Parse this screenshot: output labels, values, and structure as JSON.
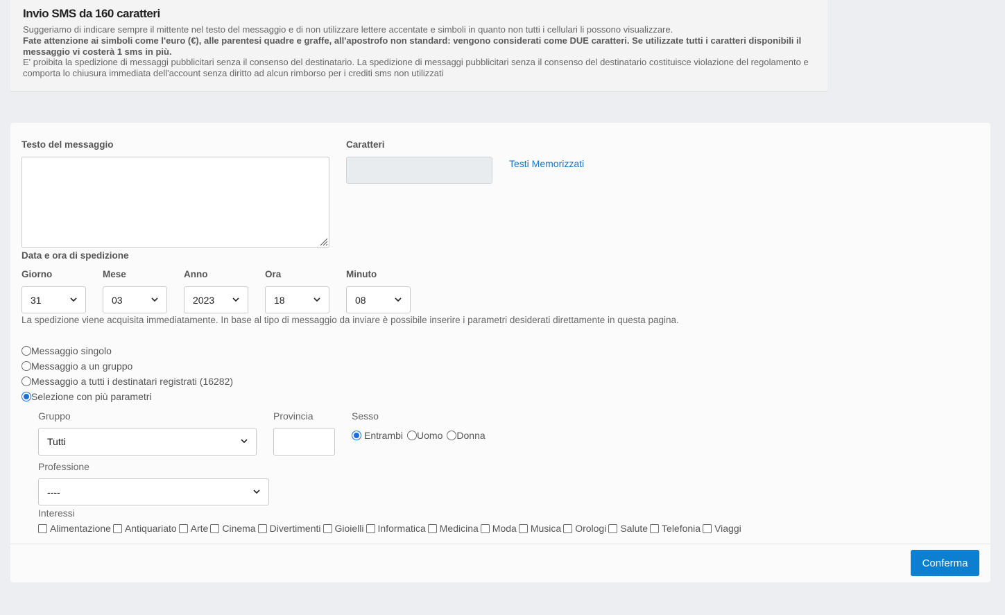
{
  "notice": {
    "title": "Invio SMS da 160 caratteri",
    "line1": "Suggeriamo di indicare sempre il mittente nel testo del messaggio e di non utilizzare lettere accentate e simboli in quanto non tutti i cellulari li possono visualizzare.",
    "bold_line": "Fate attenzione ai simboli come l'euro (€), alle parentesi quadre e graffe, all'apostrofo non standard: vengono considerati come DUE caratteri. Se utilizzate tutti i caratteri disponibili il messaggio vi costerà 1 sms in più.",
    "line3": "E' proibita la spedizione di messaggi pubblicitari senza il consenso del destinatario. La spedizione di messaggi pubblicitari senza il consenso del destinatario costituisce violazione del regolamento e comporta lo chiusura immediata dell'account senza diritto ad alcun rimborso per i crediti sms non utilizzati"
  },
  "form": {
    "message_label": "Testo del messaggio",
    "chars_label": "Caratteri",
    "saved_texts_link": "Testi Memorizzati",
    "datetime_label": "Data e ora di spedizione",
    "day_label": "Giorno",
    "day_value": "31",
    "month_label": "Mese",
    "month_value": "03",
    "year_label": "Anno",
    "year_value": "2023",
    "hour_label": "Ora",
    "hour_value": "18",
    "minute_label": "Minuto",
    "minute_value": "08",
    "schedule_note": "La spedizione viene acquisita immediatamente. In base al tipo di messaggio da inviare è possibile inserire i parametri desiderati direttamente in questa pagina.",
    "recipient_options": [
      {
        "label": "Messaggio singolo",
        "selected": false
      },
      {
        "label": "Messaggio a un gruppo",
        "selected": false
      },
      {
        "label": "Messaggio a tutti i destinatari registrati (16282)",
        "selected": false
      },
      {
        "label": "Selezione con più parametri",
        "selected": true
      }
    ],
    "group_label": "Gruppo",
    "group_value": "Tutti",
    "province_label": "Provincia",
    "province_value": "",
    "sex_label": "Sesso",
    "sex_options": [
      {
        "label": "Entrambi",
        "selected": true
      },
      {
        "label": "Uomo",
        "selected": false
      },
      {
        "label": "Donna",
        "selected": false
      }
    ],
    "profession_label": "Professione",
    "profession_value": "----",
    "interests_label": "Interessi",
    "interests": [
      "Alimentazione",
      "Antiquariato",
      "Arte",
      "Cinema",
      "Divertimenti",
      "Gioielli",
      "Informatica",
      "Medicina",
      "Moda",
      "Musica",
      "Orologi",
      "Salute",
      "Telefonia",
      "Viaggi"
    ],
    "confirm_label": "Conferma"
  },
  "colors": {
    "accent": "#0c7fd0",
    "link": "#1a73c4",
    "radio_selected": "#1a6ed8"
  }
}
